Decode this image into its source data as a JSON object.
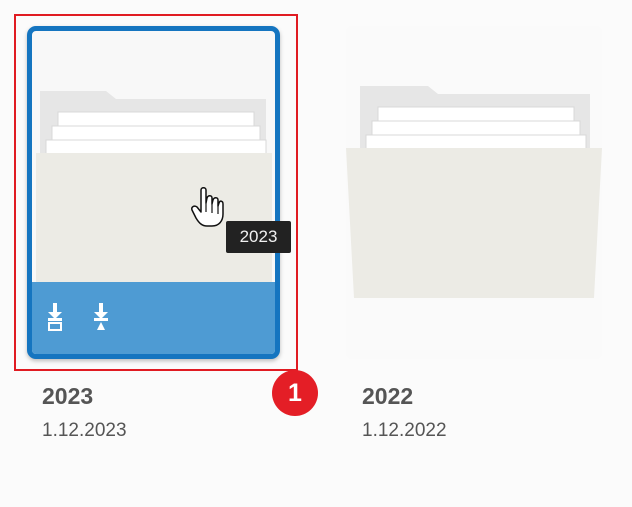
{
  "items": [
    {
      "title": "2023",
      "date": "1.12.2023",
      "tooltip": "2023",
      "selected": true
    },
    {
      "title": "2022",
      "date": "1.12.2022",
      "selected": false
    }
  ],
  "callout": {
    "number": "1",
    "color": "#e41e26"
  },
  "selection_color": "#1575c0",
  "overlay_color": "#4e9bd3",
  "icons": [
    "folder-icon",
    "download-icon",
    "download-pdf-icon",
    "hand-cursor-icon"
  ]
}
